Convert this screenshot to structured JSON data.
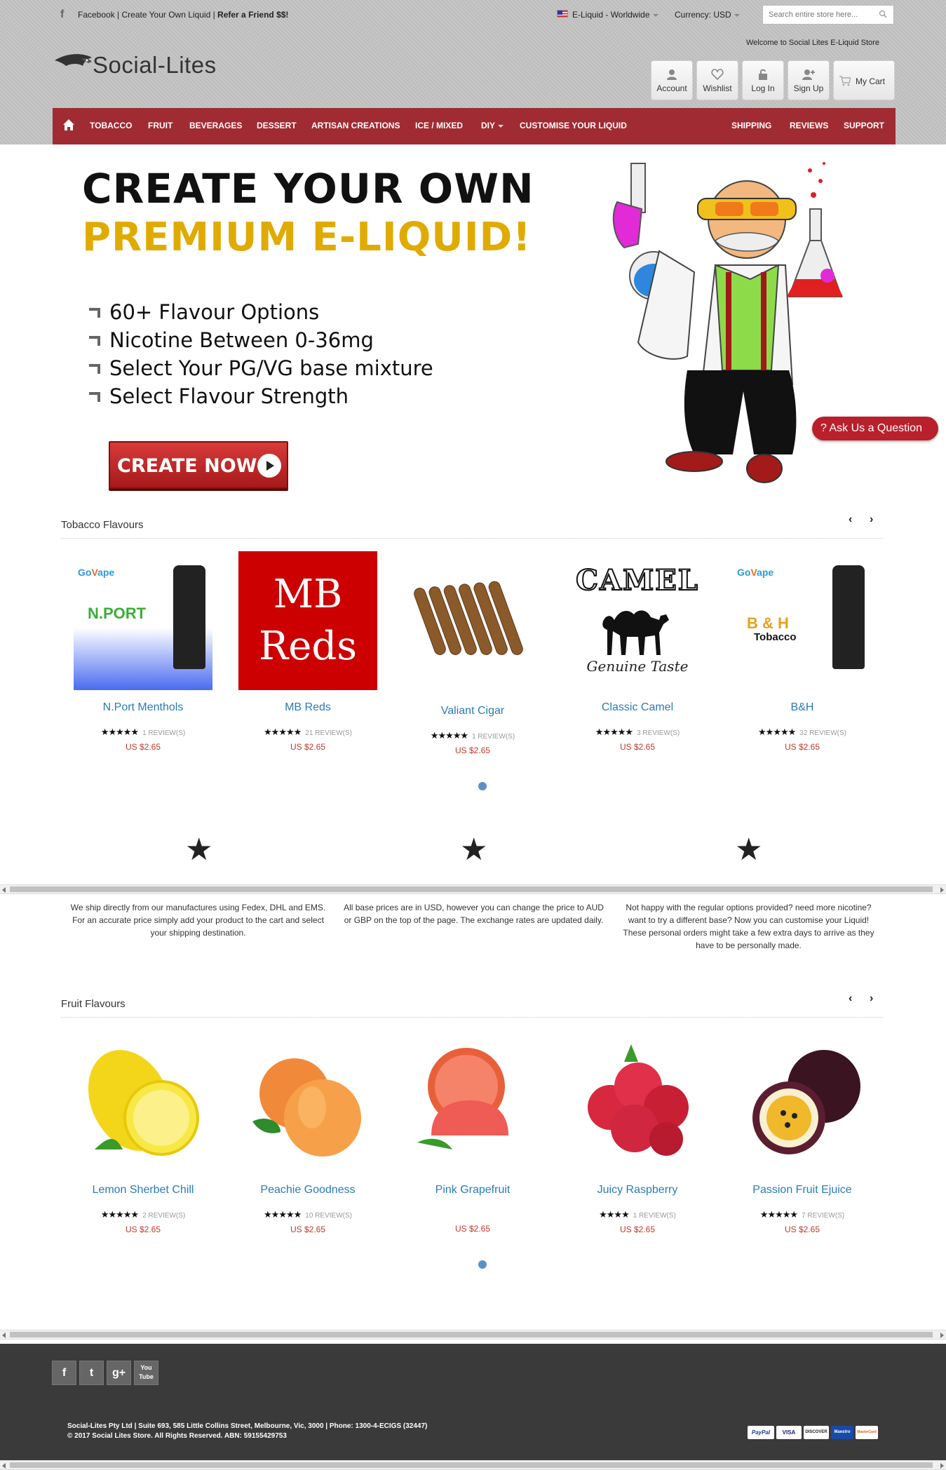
{
  "topbar": {
    "facebook_label": "Facebook",
    "links_text": "| Create Your Own Liquid |",
    "refer_text": "Refer a Friend $$!",
    "store_selector": "E-Liquid - Worldwide",
    "currency_label": "Currency:",
    "currency_value": "USD",
    "search_placeholder": "Search entire store here...",
    "welcome": "Welcome to Social Lites E-Liquid Store"
  },
  "logo": {
    "text": "Social-Lites"
  },
  "header_buttons": [
    {
      "label": "Account",
      "icon": "user-icon"
    },
    {
      "label": "Wishlist",
      "icon": "heart-icon"
    },
    {
      "label": "Log In",
      "icon": "lock-icon"
    },
    {
      "label": "Sign Up",
      "icon": "user-plus-icon"
    },
    {
      "label": "My Cart",
      "icon": "cart-icon"
    }
  ],
  "nav": {
    "items": [
      "TOBACCO",
      "FRUIT",
      "BEVERAGES",
      "DESSERT",
      "ARTISAN CREATIONS",
      "ICE / MIXED",
      "DIY",
      "CUSTOMISE YOUR LIQUID"
    ],
    "right_items": [
      "SHIPPING",
      "REVIEWS",
      "SUPPORT"
    ]
  },
  "hero": {
    "title_line1": "CREATE YOUR OWN",
    "title_line2": "PREMIUM E-LIQUID!",
    "bullets": [
      "60+ Flavour Options",
      "Nicotine Between 0-36mg",
      "Select Your PG/VG base mixture",
      "Select Flavour Strength"
    ],
    "cta_label": "CREATE NOW"
  },
  "ask_button": {
    "label": "? Ask Us a Question"
  },
  "tobacco": {
    "title": "Tobacco Flavours",
    "products": [
      {
        "name": "N.Port Menthols",
        "stars": "★★★★★",
        "reviews": "1 REVIEW(S)",
        "price": "US $2.65",
        "img_text": "N.PORT"
      },
      {
        "name": "MB Reds",
        "stars": "★★★★★",
        "reviews": "21 REVIEW(S)",
        "price": "US $2.65",
        "img_text": "MB Reds"
      },
      {
        "name": "Valiant Cigar",
        "stars": "★★★★★",
        "reviews": "1 REVIEW(S)",
        "price": "US $2.65",
        "img_text": ""
      },
      {
        "name": "Classic Camel",
        "stars": "★★★★★",
        "reviews": "3 REVIEW(S)",
        "price": "US $2.65",
        "img_text": "CAMEL"
      },
      {
        "name": "B&H",
        "stars": "★★★★★",
        "reviews": "32 REVIEW(S)",
        "price": "US $2.65",
        "img_text": "B & H"
      }
    ]
  },
  "features": [
    {
      "icon": "star-icon",
      "text": "We ship directly from our manufactures using Fedex, DHL and EMS. For an accurate price simply add your product to the cart and select your shipping destination."
    },
    {
      "icon": "star-icon",
      "text": "All base prices are in USD, however you can change the price to AUD or GBP on the top of the page. The exchange rates are updated daily."
    },
    {
      "icon": "star-icon",
      "text": "Not happy with the regular options provided? need more nicotine? want to try a different base? Now you can customise your Liquid! These personal orders might take a few extra days to arrive as they have to be personally made."
    }
  ],
  "fruit": {
    "title": "Fruit Flavours",
    "products": [
      {
        "name": "Lemon Sherbet Chill",
        "stars": "★★★★★",
        "reviews": "2 REVIEW(S)",
        "price": "US $2.65",
        "color": "#f5e02a"
      },
      {
        "name": "Peachie Goodness",
        "stars": "★★★★★",
        "reviews": "10 REVIEW(S)",
        "price": "US $2.65",
        "color": "#f4a04a"
      },
      {
        "name": "Pink Grapefruit",
        "stars": "",
        "reviews": "",
        "price": "US $2.65",
        "color": "#ec6a55"
      },
      {
        "name": "Juicy Raspberry",
        "stars": "★★★★",
        "reviews": "1 REVIEW(S)",
        "price": "US $2.65",
        "color": "#d8283f"
      },
      {
        "name": "Passion Fruit Ejuice",
        "stars": "★★★★★",
        "reviews": "7 REVIEW(S)",
        "price": "US $2.65",
        "color": "#4a1a28"
      }
    ]
  },
  "footer": {
    "social": [
      "f",
      "t",
      "g+",
      "You Tube"
    ],
    "address": "Social-Lites Pty Ltd | Suite 693, 585 Little Collins Street, Melbourne, Vic, 3000 | Phone: 1300-4-ECIGS (32447)",
    "copyright": "© 2017 Social Lites Store. All Rights Reserved. ABN: 59155429753",
    "payments": [
      "PayPal",
      "VISA",
      "DISCOVER",
      "Maestro",
      "MasterCard"
    ]
  }
}
